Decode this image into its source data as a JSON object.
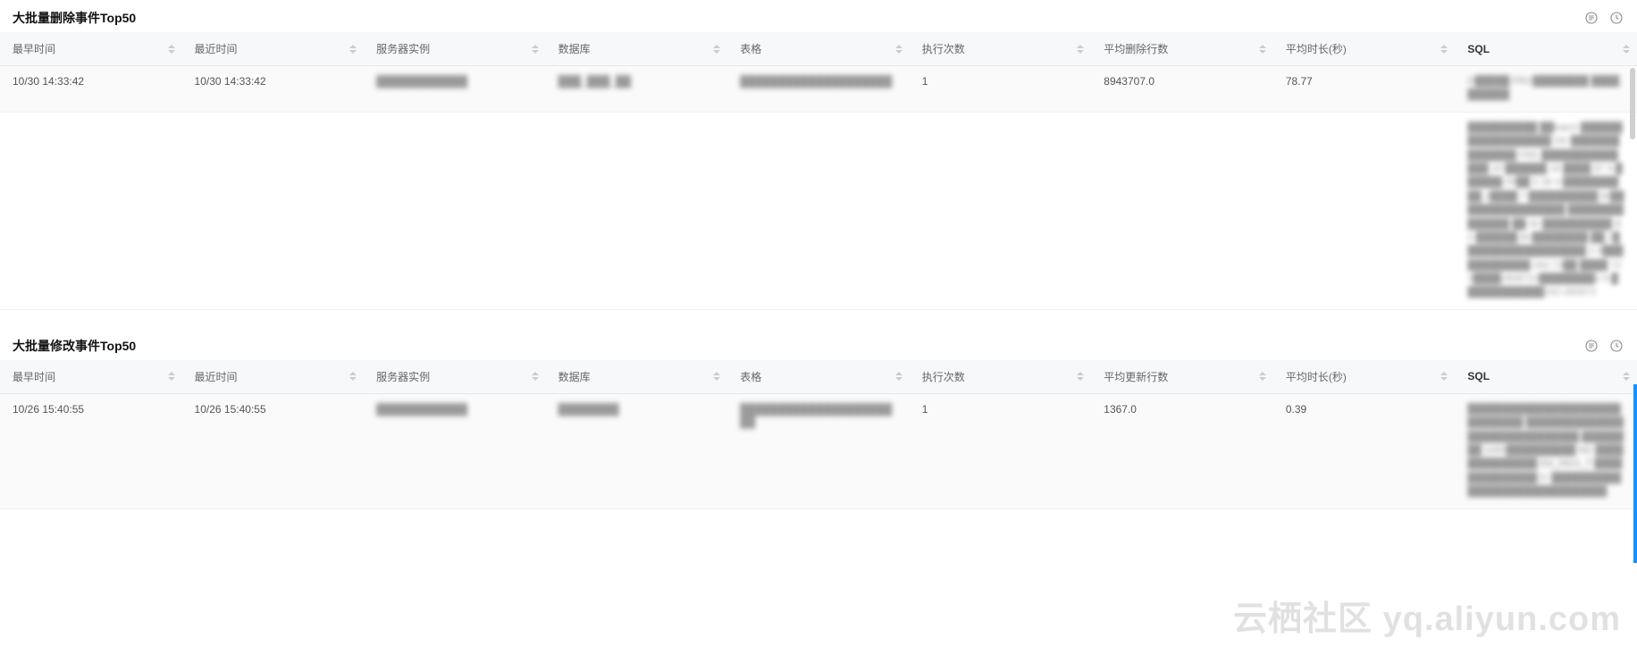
{
  "watermark": "云栖社区 yq.aliyun.com",
  "panels": [
    {
      "title": "大批量删除事件Top50",
      "headers": {
        "earliest": "最早时间",
        "latest": "最近时间",
        "server": "服务器实例",
        "db": "数据库",
        "table": "表格",
        "exec": "执行次数",
        "avgRows": "平均删除行数",
        "avgDur": "平均时长(秒)",
        "sql": "SQL"
      },
      "rows": [
        {
          "earliest": "10/30 14:33:42",
          "latest": "10/30 14:33:42",
          "server": "████████████",
          "db": "███_███_██",
          "table": "████████████████████",
          "exec": "1",
          "avgRows": "8943707.0",
          "avgDur": "78.77",
          "sql": "D█████ FRO████████ ██████████"
        },
        {
          "earliest": "",
          "latest": "",
          "server": "",
          "db": "",
          "table": "",
          "exec": "",
          "avgRows": "",
          "avgDur": "",
          "sql": "██████████ ██batch ██████████████████ DD ██████████████ FRE ██████████████ 18 ██████ 18 ████ 87 9 ██████ 05██ 5 28 3 ██████████ 2████ 7 ██████████ BI██ ██████████████ ██████████████ ██ 30 ██████████ B0 ██████ B0████████ ██ 2██████████████████ 2 9████████████ 283 73██ ████ 723████2808723████████2 9 ████████████243  280872"
        }
      ]
    },
    {
      "title": "大批量修改事件Top50",
      "headers": {
        "earliest": "最早时间",
        "latest": "最近时间",
        "server": "服务器实例",
        "db": "数据库",
        "table": "表格",
        "exec": "执行次数",
        "avgRows": "平均更新行数",
        "avgDur": "平均时长(秒)",
        "sql": "SQL"
      },
      "rows": [
        {
          "earliest": "10/26 15:40:55",
          "latest": "10/26 15:40:55",
          "server": "████████████",
          "db": "████████",
          "table": "██████████████████████",
          "exec": "1",
          "avgRows": "1367.0",
          "avgDur": "0.39",
          "sql": "██████████████████████████████ ██████████████████████████████ ████████ 1000██████████ ND ██████████████ RA_REG_T ██████████████ 0- ██████████████████████████████"
        }
      ]
    }
  ]
}
